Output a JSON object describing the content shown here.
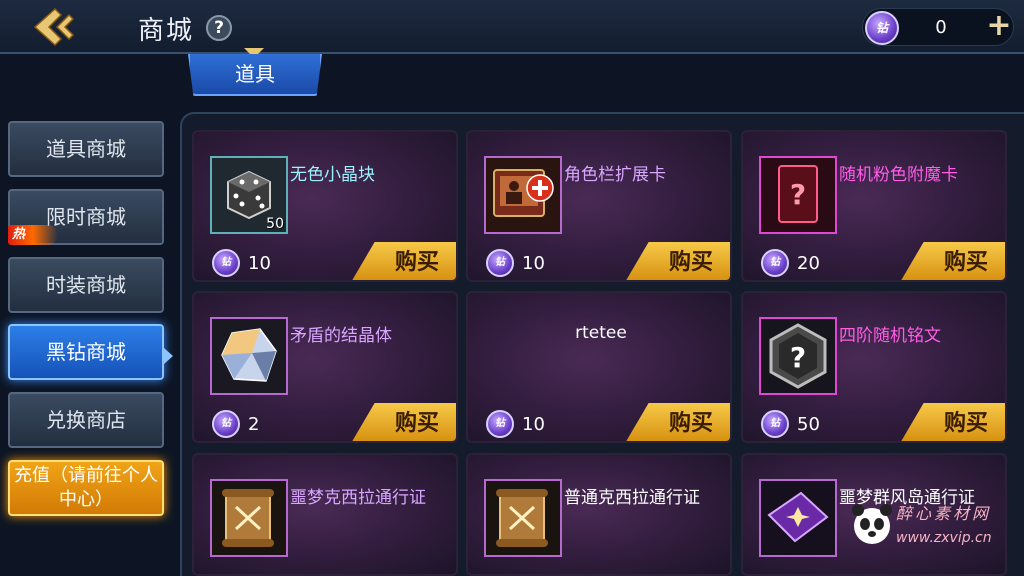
{
  "header": {
    "title": "商城",
    "help": "?",
    "currency_icon": "钻",
    "currency_value": "0",
    "add": "+"
  },
  "tab": {
    "label": "道具"
  },
  "sidebar": {
    "items": [
      {
        "label": "道具商城"
      },
      {
        "label": "限时商城"
      },
      {
        "label": "时装商城"
      },
      {
        "label": "黑钻商城"
      },
      {
        "label": "兑换商店"
      },
      {
        "label": "充值（请前往个人中心）"
      }
    ],
    "hot_badge": "热",
    "active_index": 3
  },
  "buy_label": "购买",
  "coin_label": "钻",
  "items": [
    {
      "name": "无色小晶块",
      "qty": "50",
      "price": "10",
      "icon": "dice-crystal-icon"
    },
    {
      "name": "角色栏扩展卡",
      "qty": "",
      "price": "10",
      "icon": "slot-card-icon"
    },
    {
      "name": "随机粉色附魔卡",
      "qty": "",
      "price": "20",
      "icon": "mystery-card-icon"
    },
    {
      "name": "矛盾的结晶体",
      "qty": "",
      "price": "2",
      "icon": "crystal-icon"
    },
    {
      "name": "rtetee",
      "qty": "",
      "price": "10",
      "icon": ""
    },
    {
      "name": "四阶随机铭文",
      "qty": "",
      "price": "50",
      "icon": "hexagon-question-icon"
    },
    {
      "name": "噩梦克西拉通行证",
      "qty": "",
      "price": "",
      "icon": "scroll-icon"
    },
    {
      "name": "普通克西拉通行证",
      "qty": "",
      "price": "",
      "icon": "scroll-icon"
    },
    {
      "name": "噩梦群风岛通行证",
      "qty": "",
      "price": "",
      "icon": "ticket-icon"
    }
  ],
  "watermark": {
    "text": "醉心素材网",
    "url": "www.zxvip.cn"
  },
  "colors": {
    "accent": "#2d7fe8",
    "gold": "#f0a416",
    "cyan_name": "#9cf2ff",
    "purple_name": "#d8a6ff",
    "pink_name": "#ff5ce8"
  }
}
